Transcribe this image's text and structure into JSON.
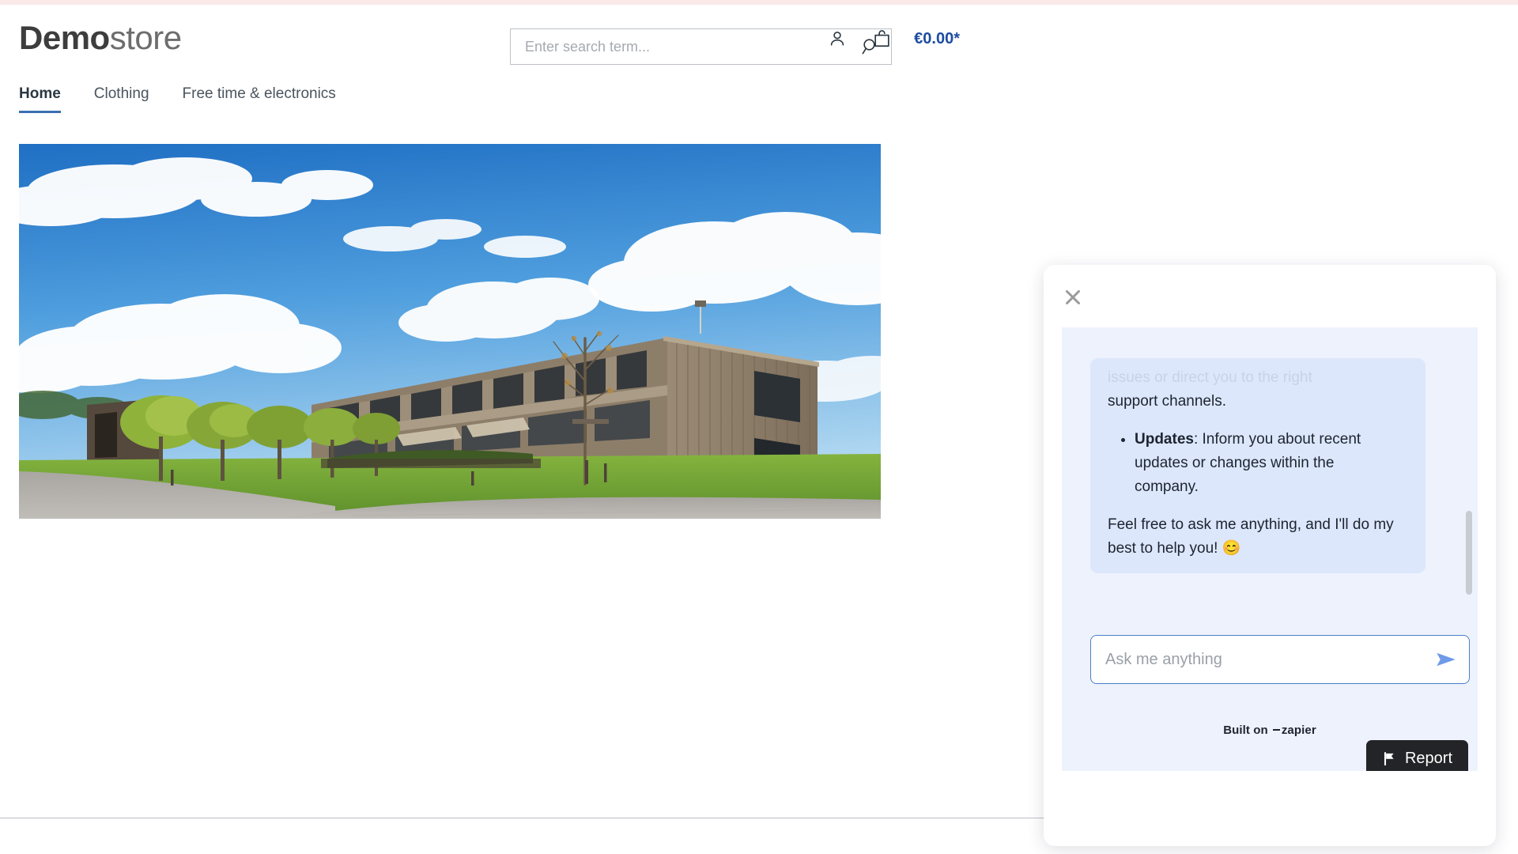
{
  "site": {
    "logo_bold": "Demo",
    "logo_light": "store"
  },
  "search": {
    "placeholder": "Enter search term...",
    "value": "",
    "icon": "search-icon"
  },
  "header": {
    "account_icon": "user-icon",
    "cart_icon": "shopping-bag-icon",
    "cart_total": "€0.00*"
  },
  "nav": {
    "items": [
      {
        "label": "Home",
        "active": true
      },
      {
        "label": "Clothing",
        "active": false
      },
      {
        "label": "Free time & electronics",
        "active": false
      }
    ]
  },
  "hero": {
    "alt": "Modern wooden office building with blue sky, clouds, trees and lawn"
  },
  "chat": {
    "close_icon": "close-icon",
    "messages": {
      "faded_top_line": "issues or direct you to the right",
      "continuation": "support channels.",
      "bullets": [
        {
          "bold": "Updates",
          "rest": ": Inform you about recent updates or changes within the company."
        }
      ],
      "closing": "Feel free to ask me anything, and I'll do my best to help you! 😊"
    },
    "input": {
      "placeholder": "Ask me anything",
      "value": "",
      "send_icon": "send-arrow-icon"
    },
    "footer": {
      "built_on_label": "Built on",
      "brand": "zapier",
      "report_label": "Report",
      "report_icon": "flag-icon"
    },
    "scrollbar": "vertical-scrollbar"
  },
  "colors": {
    "accent_blue": "#1d4ca0",
    "nav_underline": "#3a6fb0",
    "chat_panel_bg": "#eef2fd",
    "chat_bubble_bg": "#dce7fb",
    "input_border": "#4a7fc9",
    "send_arrow": "#6f9ae8",
    "report_bg": "#232427",
    "top_band": "#f9e9e9"
  }
}
